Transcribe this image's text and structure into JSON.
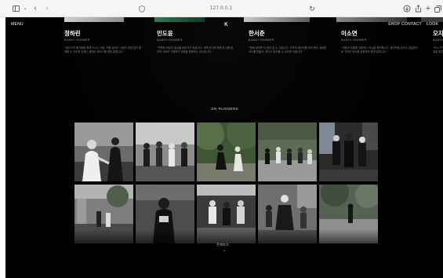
{
  "browser": {
    "url": "127.0.0.1"
  },
  "header": {
    "menu_label": "MENU",
    "logo_glyph": "κ",
    "nav": [
      "SHOP",
      "CONTACT",
      "LOOK"
    ]
  },
  "runners": [
    {
      "name": "정하린",
      "role": "BUDDY RUNNER",
      "desc": "“달리기의 즐거움을 함께 나누는 사람. 처음 달리는 사람도 부담 없이 함께할 수 있도록 언제나 곁에서 페이스를 맞춰 달립니다.”"
    },
    {
      "name": "민도윤",
      "role": "BUDDY RUNNER",
      "desc": "“꾸준한 러닝이 일상을 바꾼다고 믿습니다. 새벽 공기와 함께 도시를 달리며 서로의 기록보다 과정을 응원하는 러너입니다.”"
    },
    {
      "name": "한서준",
      "role": "BUDDY RUNNER",
      "desc": "“함께 달리면 더 멀리 갈 수 있습니다. 크루의 에너지를 모아 매주 새로운 코스를 만들고, 모두가 완주할 수 있도록 이끕니다.”"
    },
    {
      "name": "이소연",
      "role": "BUDDY RUNNER",
      "desc": "“리듬과 호흡에 집중하는 러닝을 좋아합니다. 음악처럼 흐르는 발걸음으로 각자의 속도를 존중하며 함께 달립니다.”"
    },
    {
      "name": "오지",
      "role": "BUDDY RUNNER",
      "desc": "“도시 곳곳을 달리며 새로운 길을 발견합니다.”"
    }
  ],
  "gallery": {
    "title": "ON RUNNERS",
    "more_label": "전체보기",
    "more_arrow": "⌄"
  },
  "colors": {
    "page_bg": "#000000",
    "chrome_bg": "#f5f5f5",
    "text_primary": "#ffffff",
    "text_muted": "#8a8a8a"
  },
  "icons": {
    "sidebar": "sidebar-icon",
    "chevron_down": "chevron-down-icon",
    "back": "back-icon",
    "forward": "forward-icon",
    "privacy": "privacy-icon",
    "reload": "reload-icon",
    "download": "download-icon",
    "share": "share-icon",
    "new_tab": "plus-icon",
    "tabs": "tabs-icon"
  }
}
